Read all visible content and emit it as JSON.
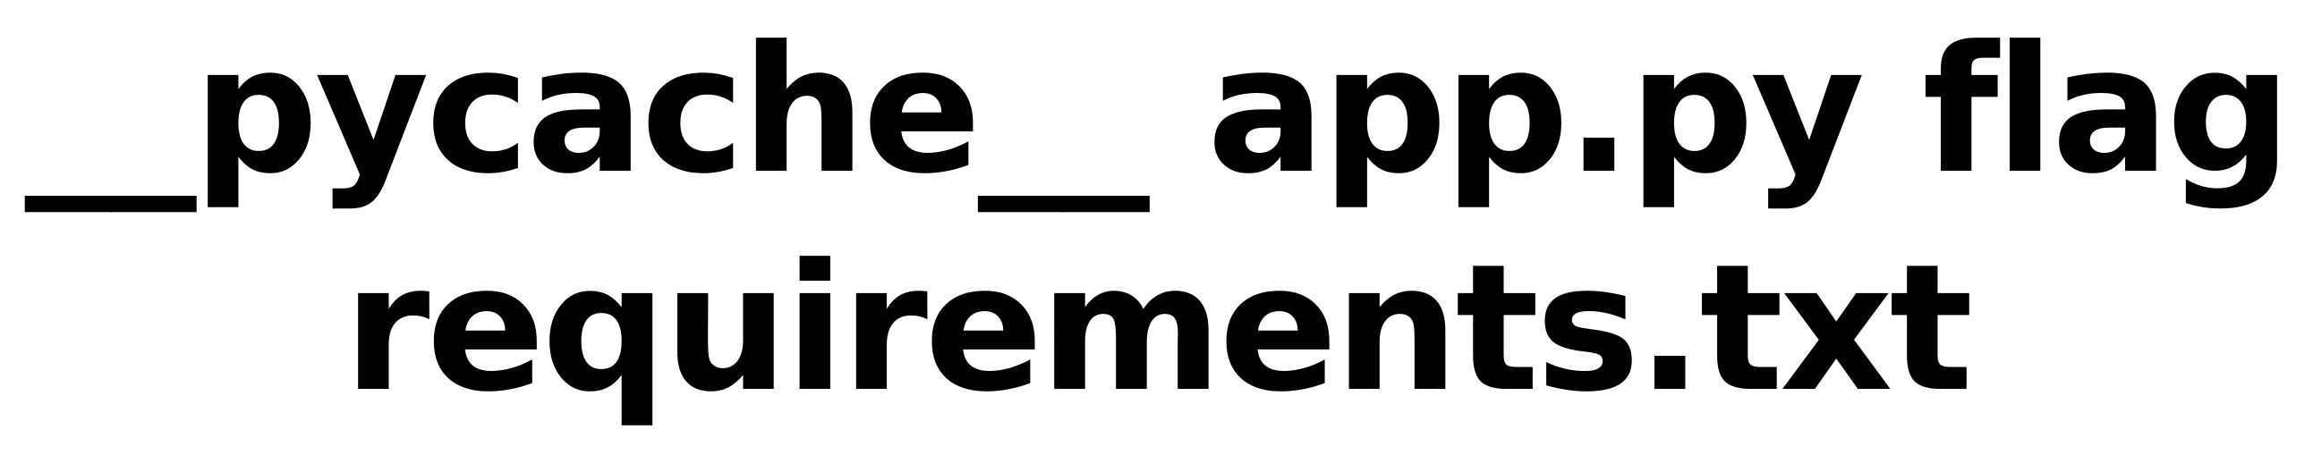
{
  "directory_listing": {
    "entries": [
      {
        "name": "__pycache__",
        "kind": "folder"
      },
      {
        "name": "app.py",
        "kind": "file"
      },
      {
        "name": "flag",
        "kind": "file"
      },
      {
        "name": "requirements.txt",
        "kind": "file"
      }
    ]
  },
  "colors": {
    "background": "#ffffff",
    "text": "#000000"
  }
}
